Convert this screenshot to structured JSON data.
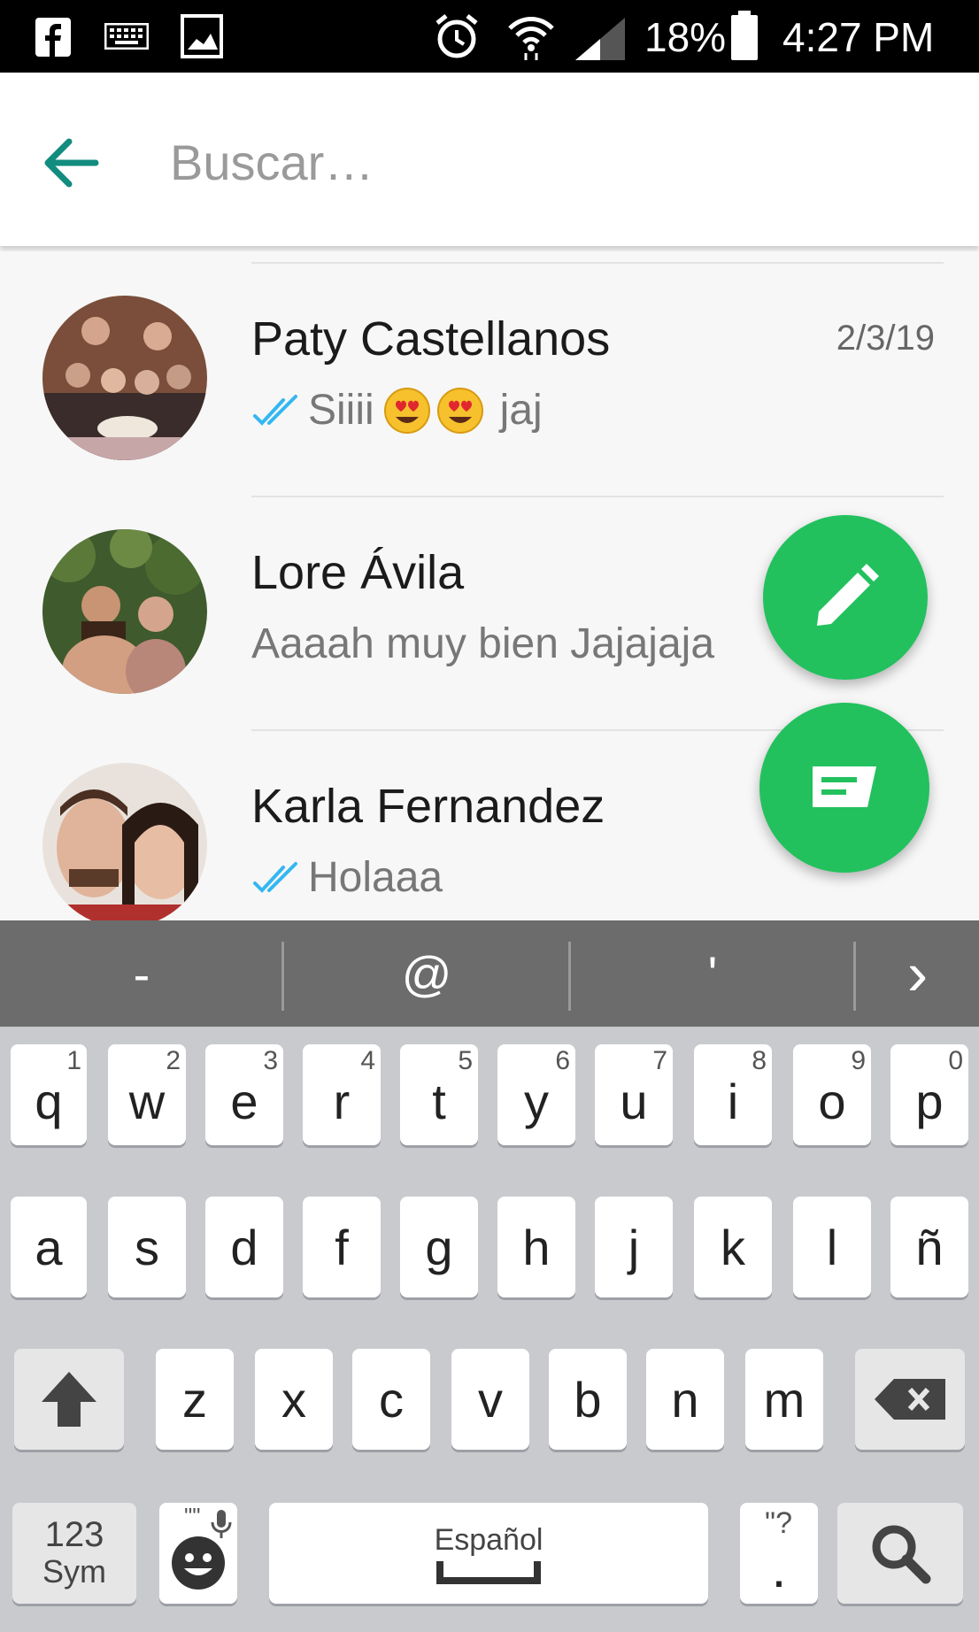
{
  "status_bar": {
    "battery": "18%",
    "time": "4:27 PM",
    "icons": [
      "facebook-icon",
      "keyboard-icon",
      "image-icon",
      "alarm-icon",
      "wifi-icon",
      "signal-icon",
      "battery-icon"
    ]
  },
  "header": {
    "back_icon": "arrow-left-icon",
    "search_placeholder": "Buscar…",
    "search_value": ""
  },
  "chats": [
    {
      "name": "Paty Castellanos",
      "date": "2/3/19",
      "message": "Siiii",
      "message_tail": "jaj",
      "emojis": 2,
      "read_ticks": true
    },
    {
      "name": "Lore Ávila",
      "date": "",
      "message": "Aaaah muy bien Jajajaja",
      "read_ticks": false
    },
    {
      "name": "Karla Fernandez",
      "date": "",
      "message": "Holaaa",
      "read_ticks": true
    }
  ],
  "fabs": {
    "edit_icon": "pencil-icon",
    "message_icon": "message-icon"
  },
  "suggestions": [
    "-",
    "@",
    "'",
    "›"
  ],
  "keyboard": {
    "row1": [
      {
        "k": "q",
        "h": "1"
      },
      {
        "k": "w",
        "h": "2"
      },
      {
        "k": "e",
        "h": "3"
      },
      {
        "k": "r",
        "h": "4"
      },
      {
        "k": "t",
        "h": "5"
      },
      {
        "k": "y",
        "h": "6"
      },
      {
        "k": "u",
        "h": "7"
      },
      {
        "k": "i",
        "h": "8"
      },
      {
        "k": "o",
        "h": "9"
      },
      {
        "k": "p",
        "h": "0"
      }
    ],
    "row2": [
      "a",
      "s",
      "d",
      "f",
      "g",
      "h",
      "j",
      "k",
      "l",
      "ñ"
    ],
    "row3": [
      "z",
      "x",
      "c",
      "v",
      "b",
      "n",
      "m"
    ],
    "sym_label_1": "123",
    "sym_label_2": "Sym",
    "space_label": "Español",
    "period_label": ".",
    "period_hint": "\"?",
    "mic_hint": "\"\"",
    "colors": {
      "fab": "#22c15e",
      "accent": "#128c7e",
      "ticks": "#34b7f1"
    }
  }
}
